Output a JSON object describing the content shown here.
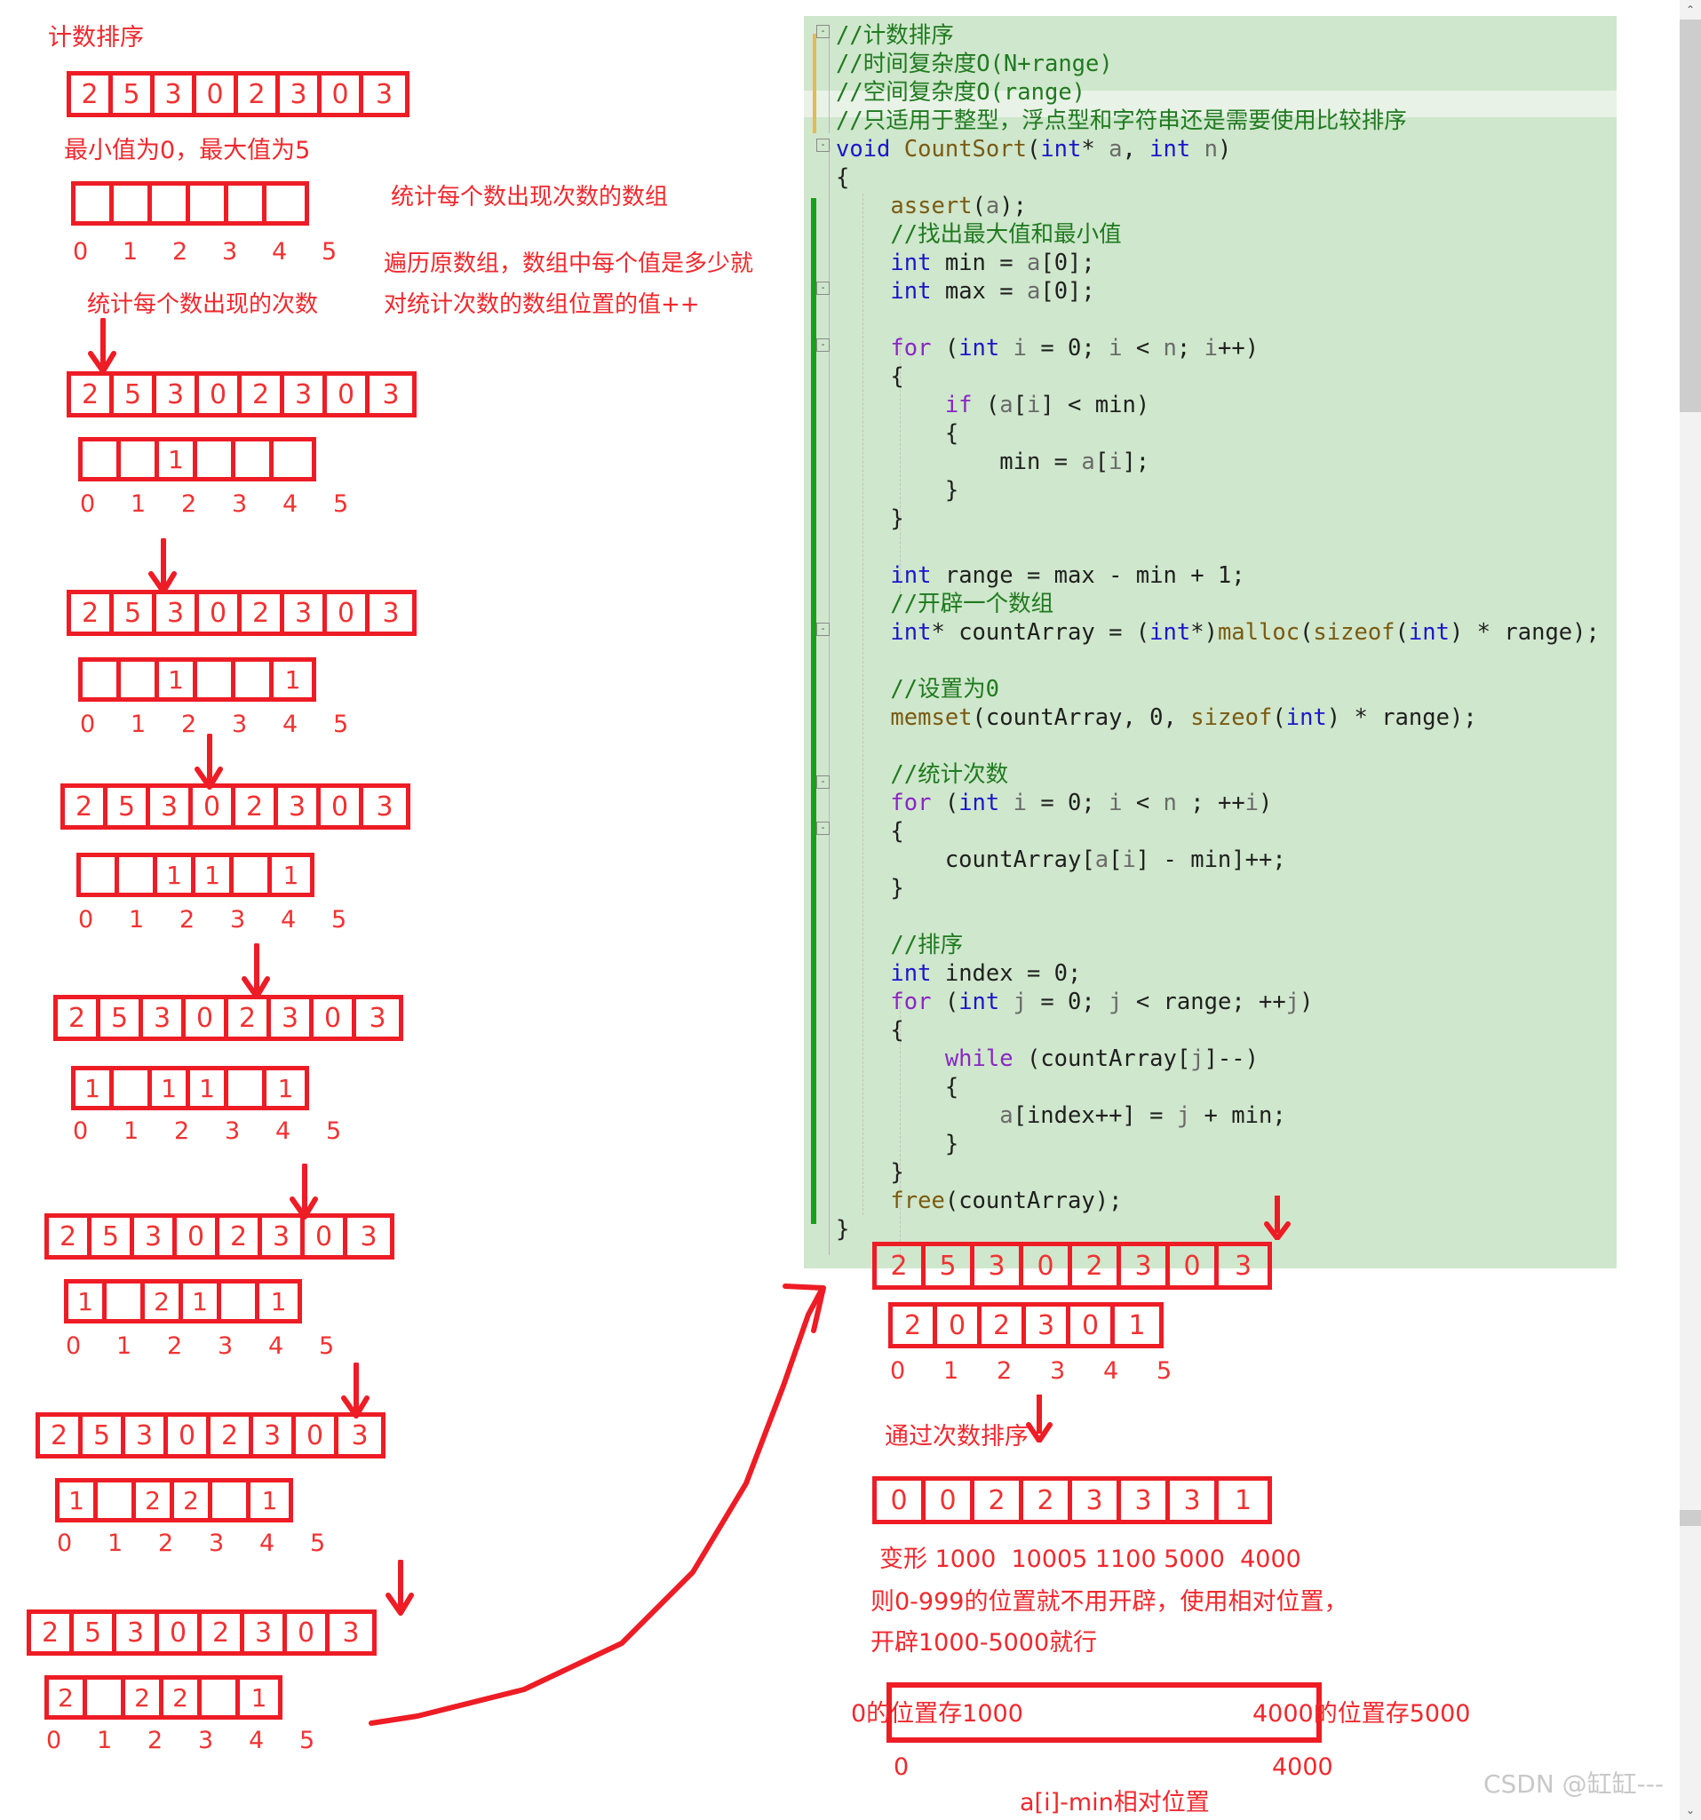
{
  "title": "计数排序",
  "left_panel": {
    "heading": "计数排序",
    "minmax_note": "最小值为0，最大值为5",
    "count_array_label": "统计每个数出现次数的数组",
    "traverse_note_line1": "遍历原数组，数组中每个值是多少就",
    "traverse_note_line2": "对统计次数的数组位置的值++",
    "count_occurrences_label": "统计每个数出现的次数",
    "source_array": [
      "2",
      "5",
      "3",
      "0",
      "2",
      "3",
      "0",
      "3"
    ],
    "index_labels": [
      "0",
      "1",
      "2",
      "3",
      "4",
      "5"
    ],
    "initial_count_array": [
      "",
      "",
      "",
      "",
      "",
      ""
    ],
    "steps": [
      {
        "array": [
          "2",
          "5",
          "3",
          "0",
          "2",
          "3",
          "0",
          "3"
        ],
        "highlight_index": 0,
        "count": [
          "",
          "",
          "1",
          "",
          "",
          ""
        ]
      },
      {
        "array": [
          "2",
          "5",
          "3",
          "0",
          "2",
          "3",
          "0",
          "3"
        ],
        "highlight_index": 1,
        "count": [
          "",
          "",
          "1",
          "",
          "",
          "1"
        ]
      },
      {
        "array": [
          "2",
          "5",
          "3",
          "0",
          "2",
          "3",
          "0",
          "3"
        ],
        "highlight_index": 2,
        "count": [
          "",
          "",
          "1",
          "1",
          "",
          "1"
        ]
      },
      {
        "array": [
          "2",
          "5",
          "3",
          "0",
          "2",
          "3",
          "0",
          "3"
        ],
        "highlight_index": 3,
        "count": [
          "1",
          "",
          "1",
          "1",
          "",
          "1"
        ]
      },
      {
        "array": [
          "2",
          "5",
          "3",
          "0",
          "2",
          "3",
          "0",
          "3"
        ],
        "highlight_index": 4,
        "count": [
          "1",
          "",
          "2",
          "1",
          "",
          "1"
        ]
      },
      {
        "array": [
          "2",
          "5",
          "3",
          "0",
          "2",
          "3",
          "0",
          "3"
        ],
        "highlight_index": 5,
        "count": [
          "1",
          "",
          "2",
          "2",
          "",
          "1"
        ]
      },
      {
        "array": [
          "2",
          "5",
          "3",
          "0",
          "2",
          "3",
          "0",
          "3"
        ],
        "highlight_index": 6,
        "count": [
          "2",
          "",
          "2",
          "2",
          "",
          "1"
        ]
      }
    ]
  },
  "code": {
    "language": "c",
    "lines": [
      "//计数排序",
      "//时间复杂度O(N+range)",
      "//空间复杂度O(range)",
      "//只适用于整型，浮点型和字符串还是需要使用比较排序",
      "void CountSort(int* a, int n)",
      "{",
      "    assert(a);",
      "    //找出最大值和最小值",
      "    int min = a[0];",
      "    int max = a[0];",
      "",
      "    for (int i = 0; i < n; i++)",
      "    {",
      "        if (a[i] < min)",
      "        {",
      "            min = a[i];",
      "        }",
      "    }",
      "",
      "    int range = max - min + 1;",
      "    //开辟一个数组",
      "    int* countArray = (int*)malloc(sizeof(int) * range);",
      "",
      "    //设置为0",
      "    memset(countArray, 0, sizeof(int) * range);",
      "",
      "    //统计次数",
      "    for (int i = 0; i < n ; ++i)",
      "    {",
      "        countArray[a[i] - min]++;",
      "    }",
      "",
      "    //排序",
      "    int index = 0;",
      "    for (int j = 0; j < range; ++j)",
      "    {",
      "        while (countArray[j]--)",
      "        {",
      "            a[index++] = j + min;",
      "        }",
      "    }",
      "    free(countArray);",
      "}"
    ]
  },
  "right_panel": {
    "result_source_array": [
      "2",
      "5",
      "3",
      "0",
      "2",
      "3",
      "0",
      "3"
    ],
    "final_count_array": [
      "2",
      "0",
      "2",
      "3",
      "0",
      "1"
    ],
    "index_labels": [
      "0",
      "1",
      "2",
      "3",
      "4",
      "5"
    ],
    "sort_by_count_label": "通过次数排序",
    "sorted_array": [
      "0",
      "0",
      "2",
      "2",
      "3",
      "3",
      "3",
      "1"
    ],
    "variant_line1": "变形 1000  10005 1100 5000  4000",
    "variant_line2": "则0-999的位置就不用开辟，使用相对位置，",
    "variant_line3": "开辟1000-5000就行",
    "box_left_label": "0的位置存1000",
    "box_right_label": "4000的位置存5000",
    "axis_left": "0",
    "axis_right": "4000",
    "relative_pos_label": "a[i]-min相对位置"
  },
  "scrollbar": {
    "up_arrow": "⌃",
    "down_arrow": "⌄"
  },
  "watermark": "CSDN @缸缸---"
}
